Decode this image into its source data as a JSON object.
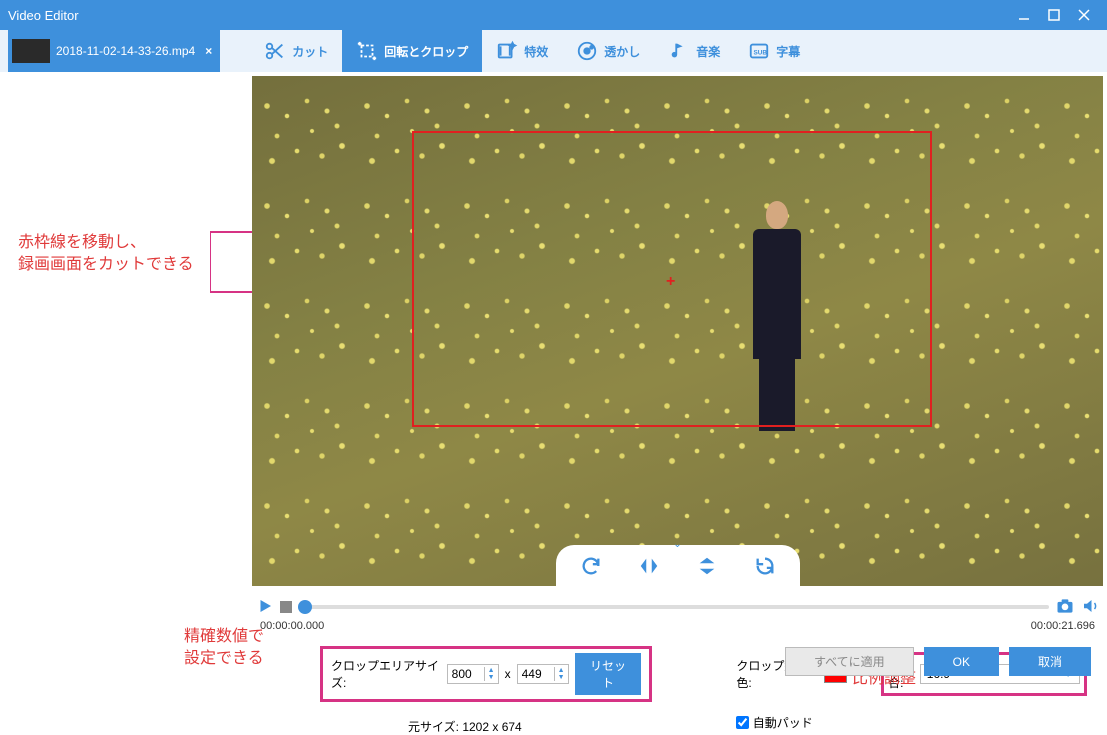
{
  "app": {
    "title": "Video Editor"
  },
  "file": {
    "name": "2018-11-02-14-33-26.mp4"
  },
  "tabs": {
    "cut": "カット",
    "rotate_crop": "回転とクロップ",
    "effect": "特效",
    "watermark": "透かし",
    "music": "音楽",
    "subtitle": "字幕"
  },
  "annotations": {
    "move_crop": "赤枠線を移動し、\n録画画面をカットできる",
    "exact_values": "精確数値で\n設定できる",
    "ratio_adjust": "比例調整"
  },
  "timeline": {
    "current": "00:00:00.000",
    "total": "00:00:21.696"
  },
  "crop": {
    "size_label": "クロップエリアサイズ:",
    "width": "800",
    "sep": "x",
    "height": "449",
    "reset": "リセット",
    "orig_label": "元サイズ:",
    "orig_value": "1202 x 674",
    "line_color_label": "クロップ線の色:",
    "ratio_label": "割合:",
    "ratio_value": "16:9",
    "auto_pad": "自動パッド"
  },
  "footer": {
    "apply_all": "すべてに適用",
    "ok": "OK",
    "cancel": "取消"
  }
}
